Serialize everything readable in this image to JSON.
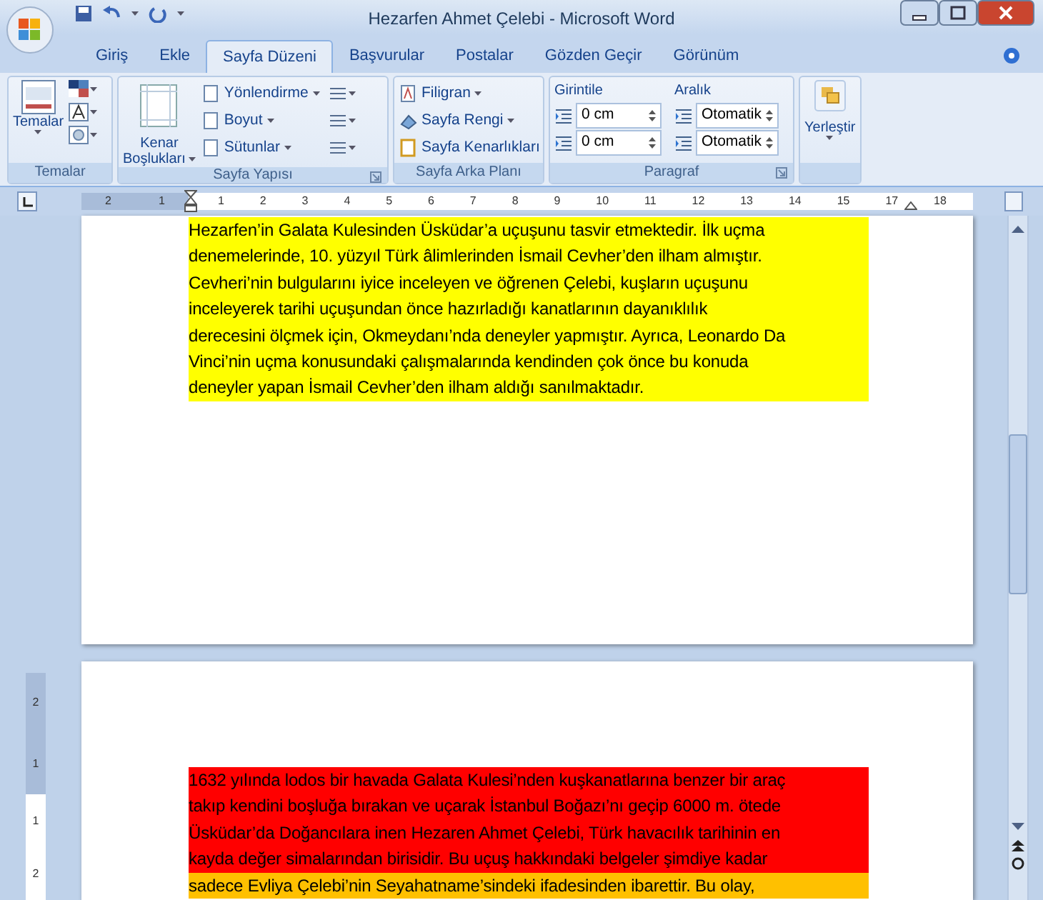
{
  "window": {
    "title": "Hezarfen Ahmet Çelebi - Microsoft Word"
  },
  "tabs": [
    {
      "label": "Giriş",
      "selected": false
    },
    {
      "label": "Ekle",
      "selected": false
    },
    {
      "label": "Sayfa Düzeni",
      "selected": true
    },
    {
      "label": "Başvurular",
      "selected": false
    },
    {
      "label": "Postalar",
      "selected": false
    },
    {
      "label": "Gözden Geçir",
      "selected": false
    },
    {
      "label": "Görünüm",
      "selected": false
    }
  ],
  "ribbon": {
    "groups": [
      {
        "kind": "themes",
        "label": "Temalar",
        "button": "Temalar"
      },
      {
        "kind": "page_setup",
        "label": "Sayfa Yapısı",
        "big_button": [
          "Kenar",
          "Boşlukları"
        ],
        "buttons": [
          "Yönlendirme",
          "Boyut",
          "Sütunlar"
        ]
      },
      {
        "kind": "page_background",
        "label": "Sayfa Arka Planı",
        "buttons": [
          "Filigran",
          "Sayfa Rengi",
          "Sayfa Kenarlıkları"
        ]
      },
      {
        "kind": "paragraph",
        "label": "Paragraf",
        "columns": [
          {
            "label": "Girintile",
            "fields": [
              "0 cm",
              "0 cm"
            ]
          },
          {
            "label": "Aralık",
            "fields": [
              "Otomatik",
              "Otomatik"
            ]
          }
        ]
      },
      {
        "kind": "arrange",
        "button": "Yerleştir"
      }
    ]
  },
  "ruler": {
    "left_numbers": [
      "2",
      "1"
    ],
    "numbers": [
      "1",
      "2",
      "3",
      "4",
      "5",
      "6",
      "7",
      "8",
      "9",
      "10",
      "11",
      "12",
      "13",
      "14",
      "15",
      "17",
      "18"
    ]
  },
  "vertical_ruler": {
    "numbers": [
      "2",
      "1",
      "1",
      "2"
    ]
  },
  "pages": [
    {
      "lines": [
        {
          "text": "Hezarfen’in Galata Kulesinden Üsküdar’a uçuşunu tasvir etmektedir. İlk uçma",
          "color": "#ffff00"
        },
        {
          "text": "denemelerinde, 10. yüzyıl Türk âlimlerinden İsmail Cevher’den ilham almıştır.",
          "color": "#ffff00"
        },
        {
          "text": "Cevheri’nin bulgularını iyice inceleyen ve öğrenen Çelebi, kuşların uçuşunu",
          "color": "#ffff00"
        },
        {
          "text": "inceleyerek tarihi uçuşundan önce hazırladığı kanatlarının dayanıklılık",
          "color": "#ffff00"
        },
        {
          "text": "derecesini ölçmek için, Okmeydanı’nda deneyler yapmıştır. Ayrıca, Leonardo Da",
          "color": "#ffff00"
        },
        {
          "text": "Vinci’nin uçma konusundaki çalışmalarında kendinden çok önce bu konuda",
          "color": "#ffff00"
        },
        {
          "text": "deneyler yapan İsmail Cevher’den ilham aldığı sanılmaktadır.",
          "color": "#ffff00"
        }
      ]
    },
    {
      "lines": [
        {
          "text": "1632 yılında lodos bir havada Galata Kulesi’nden kuşkanatlarına benzer bir araç",
          "color": "#ff0000"
        },
        {
          "text": "takıp kendini boşluğa bırakan ve uçarak İstanbul Boğazı’nı geçip 6000 m. ötede",
          "color": "#ff0000"
        },
        {
          "text": "Üsküdar’da Doğancılara inen Hezaren Ahmet Çelebi, Türk havacılık tarihinin en",
          "color": "#ff0000"
        },
        {
          "text": "kayda değer simalarından birisidir. Bu uçuş hakkındaki belgeler şimdiye kadar",
          "color": "#ff0000"
        },
        {
          "text": "sadece Evliya Çelebi’nin Seyahatname’sindeki ifadesinden ibarettir. Bu olay,",
          "color": "#ffc000"
        }
      ]
    }
  ]
}
